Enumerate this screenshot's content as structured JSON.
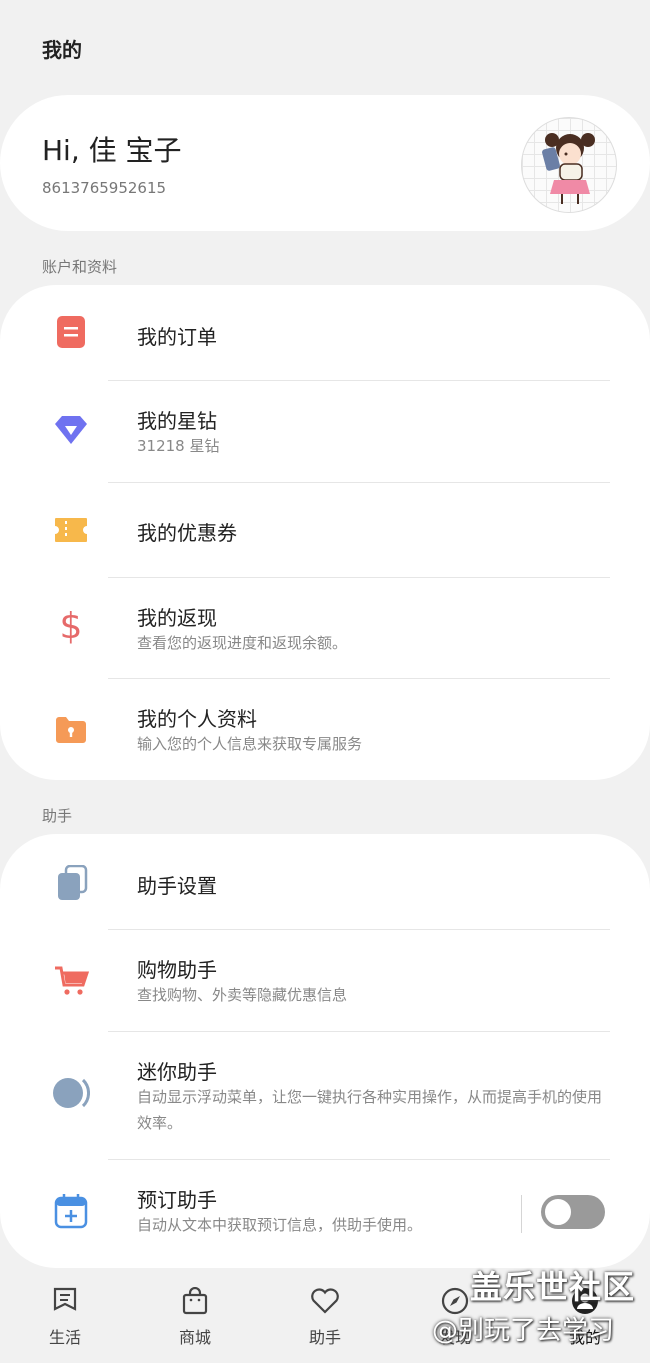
{
  "header": {
    "title": "我的"
  },
  "profile": {
    "greeting": "Hi, 佳 宝子",
    "phone": "8613765952615"
  },
  "sections": {
    "account_label": "账户和资料",
    "assistant_label": "助手"
  },
  "account_items": [
    {
      "icon": "order-icon",
      "title": "我的订单",
      "color": "#ef6b60"
    },
    {
      "icon": "diamond-icon",
      "title": "我的星钻",
      "subtitle": "31218 星钻",
      "color": "#6f72f0"
    },
    {
      "icon": "coupon-icon",
      "title": "我的优惠券",
      "color": "#f7b84b"
    },
    {
      "icon": "dollar-icon",
      "title": "我的返现",
      "subtitle": "查看您的返现进度和返现余额。",
      "color": "#e66a6a"
    },
    {
      "icon": "profile-folder-icon",
      "title": "我的个人资料",
      "subtitle": "输入您的个人信息来获取专属服务",
      "color": "#f59a57"
    }
  ],
  "assistant_items": [
    {
      "icon": "cards-icon",
      "title": "助手设置",
      "color": "#8aa2bd"
    },
    {
      "icon": "cart-icon",
      "title": "购物助手",
      "subtitle": "查找购物、外卖等隐藏优惠信息",
      "color": "#ef6b60"
    },
    {
      "icon": "mini-assistant-icon",
      "title": "迷你助手",
      "subtitle": "自动显示浮动菜单，让您一键执行各种实用操作，从而提高手机的使用效率。",
      "color": "#8aa2bd"
    },
    {
      "icon": "calendar-add-icon",
      "title": "预订助手",
      "subtitle": "自动从文本中获取预订信息，供助手使用。",
      "color": "#4a90e2",
      "toggle": false
    }
  ],
  "bottom_nav": [
    {
      "icon": "life-icon",
      "label": "生活"
    },
    {
      "icon": "shop-bag-icon",
      "label": "商城"
    },
    {
      "icon": "heart-icon",
      "label": "助手"
    },
    {
      "icon": "compass-icon",
      "label": "发现"
    },
    {
      "icon": "me-icon",
      "label": "我的",
      "active": true
    }
  ],
  "watermark": {
    "line1": "盖乐世社区",
    "line2": "@别玩了去学习"
  }
}
